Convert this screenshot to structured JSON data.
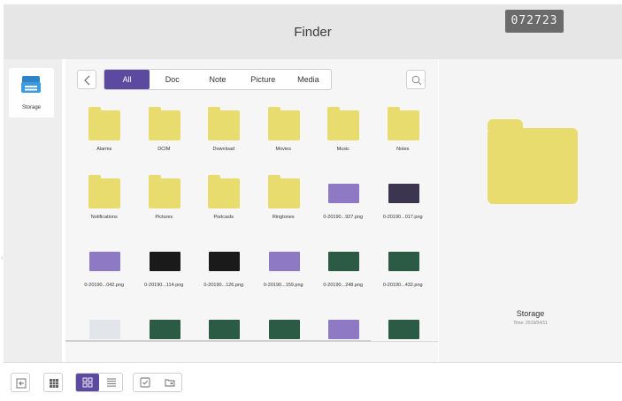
{
  "header": {
    "title": "Finder",
    "code": "072723"
  },
  "sidebar": {
    "items": [
      {
        "label": "Storage",
        "icon": "storage-drive-icon"
      }
    ]
  },
  "colors": {
    "accent": "#5b4aa0",
    "folder": "#e8dc6e",
    "header_bg": "#e6e6e6"
  },
  "filters": {
    "tabs": [
      "All",
      "Doc",
      "Note",
      "Picture",
      "Media"
    ],
    "active": "All"
  },
  "files": [
    {
      "name": "Alarms",
      "kind": "folder"
    },
    {
      "name": "DCIM",
      "kind": "folder"
    },
    {
      "name": "Download",
      "kind": "folder"
    },
    {
      "name": "Movies",
      "kind": "folder"
    },
    {
      "name": "Music",
      "kind": "folder"
    },
    {
      "name": "Notes",
      "kind": "folder"
    },
    {
      "name": "Notifications",
      "kind": "folder"
    },
    {
      "name": "Pictures",
      "kind": "folder"
    },
    {
      "name": "Podcasts",
      "kind": "folder"
    },
    {
      "name": "Ringtones",
      "kind": "folder"
    },
    {
      "name": "0-20190...927.png",
      "kind": "image",
      "thumb": "purple"
    },
    {
      "name": "0-20190...017.png",
      "kind": "image",
      "thumb": "darkpurple"
    },
    {
      "name": "0-20190...042.png",
      "kind": "image",
      "thumb": "purple"
    },
    {
      "name": "0-20190...114.png",
      "kind": "image",
      "thumb": "dark"
    },
    {
      "name": "0-20190...126.png",
      "kind": "image",
      "thumb": "dark"
    },
    {
      "name": "0-20190...159.png",
      "kind": "image",
      "thumb": "purple"
    },
    {
      "name": "0-20190...248.png",
      "kind": "image",
      "thumb": "green"
    },
    {
      "name": "0-20190...432.png",
      "kind": "image",
      "thumb": "green"
    },
    {
      "name": "",
      "kind": "image",
      "thumb": "light"
    },
    {
      "name": "",
      "kind": "image",
      "thumb": "green"
    },
    {
      "name": "",
      "kind": "image",
      "thumb": "green"
    },
    {
      "name": "",
      "kind": "image",
      "thumb": "green"
    },
    {
      "name": "",
      "kind": "image",
      "thumb": "purple"
    },
    {
      "name": "",
      "kind": "image",
      "thumb": "green"
    }
  ],
  "selection": {
    "name": "Storage",
    "time": "Time: 2019/04/11"
  },
  "toolbar": {
    "buttons": [
      "exit-icon",
      "apps-grid-icon",
      "grid-view-icon",
      "list-view-icon",
      "select-checkbox-icon",
      "move-folder-icon"
    ],
    "active_view": "grid"
  }
}
